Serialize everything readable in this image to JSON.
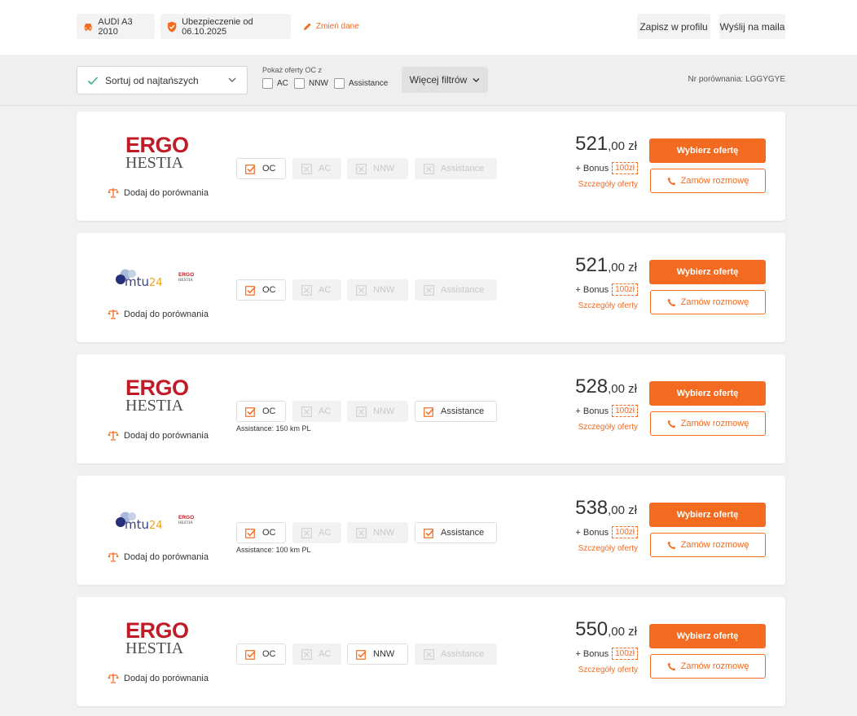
{
  "header": {
    "car_label": "AUDI A3 2010",
    "insurance_label": "Ubezpieczenie od 06.10.2025",
    "edit_label": "Zmień dane",
    "save_profile_label": "Zapisz w profilu",
    "send_mail_label": "Wyślij na maila"
  },
  "filters": {
    "sort_label": "Sortuj od najtańszych",
    "show_offers_label": "Pokaż oferty OC z",
    "options": [
      "AC",
      "NNW",
      "Assistance"
    ],
    "more_filters_label": "Więcej filtrów",
    "comparison_number": "Nr porównania: LGGYGYE"
  },
  "colors": {
    "accent": "#f26b21",
    "ergo_red": "#c01c28"
  },
  "labels": {
    "compare": "Dodaj do porównania",
    "choose": "Wybierz ofertę",
    "callback": "Zamów rozmowę",
    "bonus_prefix": "+ Bonus",
    "details": "Szczegóły oferty"
  },
  "offers": [
    {
      "logo": "ergo-hestia-logo",
      "logo_text": [
        "ERGO",
        "HESTIA"
      ],
      "price_int": "521",
      "price_dec": ",00 zł",
      "bonus": "100zł",
      "coverages": [
        {
          "label": "OC",
          "active": true
        },
        {
          "label": "AC",
          "active": false
        },
        {
          "label": "NNW",
          "active": false
        },
        {
          "label": "Assistance",
          "active": false
        }
      ],
      "note": ""
    },
    {
      "logo": "mtu24-logo",
      "logo_text": [
        "mtu24",
        "ERGO",
        "HESTIA"
      ],
      "price_int": "521",
      "price_dec": ",00 zł",
      "bonus": "100zł",
      "coverages": [
        {
          "label": "OC",
          "active": true
        },
        {
          "label": "AC",
          "active": false
        },
        {
          "label": "NNW",
          "active": false
        },
        {
          "label": "Assistance",
          "active": false
        }
      ],
      "note": ""
    },
    {
      "logo": "ergo-hestia-logo",
      "logo_text": [
        "ERGO",
        "HESTIA"
      ],
      "price_int": "528",
      "price_dec": ",00 zł",
      "bonus": "100zł",
      "coverages": [
        {
          "label": "OC",
          "active": true
        },
        {
          "label": "AC",
          "active": false
        },
        {
          "label": "NNW",
          "active": false
        },
        {
          "label": "Assistance",
          "active": true
        }
      ],
      "note": "Assistance:  150 km PL"
    },
    {
      "logo": "mtu24-logo",
      "logo_text": [
        "mtu24",
        "ERGO",
        "HESTIA"
      ],
      "price_int": "538",
      "price_dec": ",00 zł",
      "bonus": "100zł",
      "coverages": [
        {
          "label": "OC",
          "active": true
        },
        {
          "label": "AC",
          "active": false
        },
        {
          "label": "NNW",
          "active": false
        },
        {
          "label": "Assistance",
          "active": true
        }
      ],
      "note": "Assistance:  100 km PL"
    },
    {
      "logo": "ergo-hestia-logo",
      "logo_text": [
        "ERGO",
        "HESTIA"
      ],
      "price_int": "550",
      "price_dec": ",00 zł",
      "bonus": "100zł",
      "coverages": [
        {
          "label": "OC",
          "active": true
        },
        {
          "label": "AC",
          "active": false
        },
        {
          "label": "NNW",
          "active": true
        },
        {
          "label": "Assistance",
          "active": false
        }
      ],
      "note": ""
    }
  ]
}
